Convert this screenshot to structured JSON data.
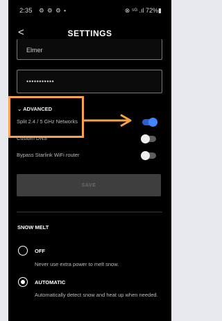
{
  "status_bar": {
    "time": "2:35",
    "notifications": "⚙ ⚙ ⚙ •",
    "right": "⊗ ⁵ᴳ .ıl 72%▮"
  },
  "header": {
    "back_icon": "chevron-left-icon",
    "back_glyph": "<",
    "title": "SETTINGS"
  },
  "wifi": {
    "name_value": "Elmer",
    "password_value": "•••••••••••"
  },
  "advanced": {
    "heading": "ADVANCED",
    "heading_icon": "chevron-down-icon",
    "heading_glyph": "⌄",
    "options": [
      {
        "label": "Split 2.4 / 5 GHz Networks",
        "state": "on"
      },
      {
        "label": "Custom DNS",
        "state": "off"
      },
      {
        "label": "Bypass Starlink WiFi router",
        "state": "off"
      }
    ]
  },
  "save_label": "SAVE",
  "snow_melt": {
    "title": "SNOW MELT",
    "options": [
      {
        "label": "OFF",
        "description": "Never use extra power to melt snow.",
        "selected": false
      },
      {
        "label": "AUTOMATIC",
        "description": "Automatically detect snow and heat up when needed.",
        "selected": true
      }
    ]
  },
  "colors": {
    "annotation": "#f5a24a",
    "toggle_on": "#3f86ff",
    "background": "#000000"
  }
}
